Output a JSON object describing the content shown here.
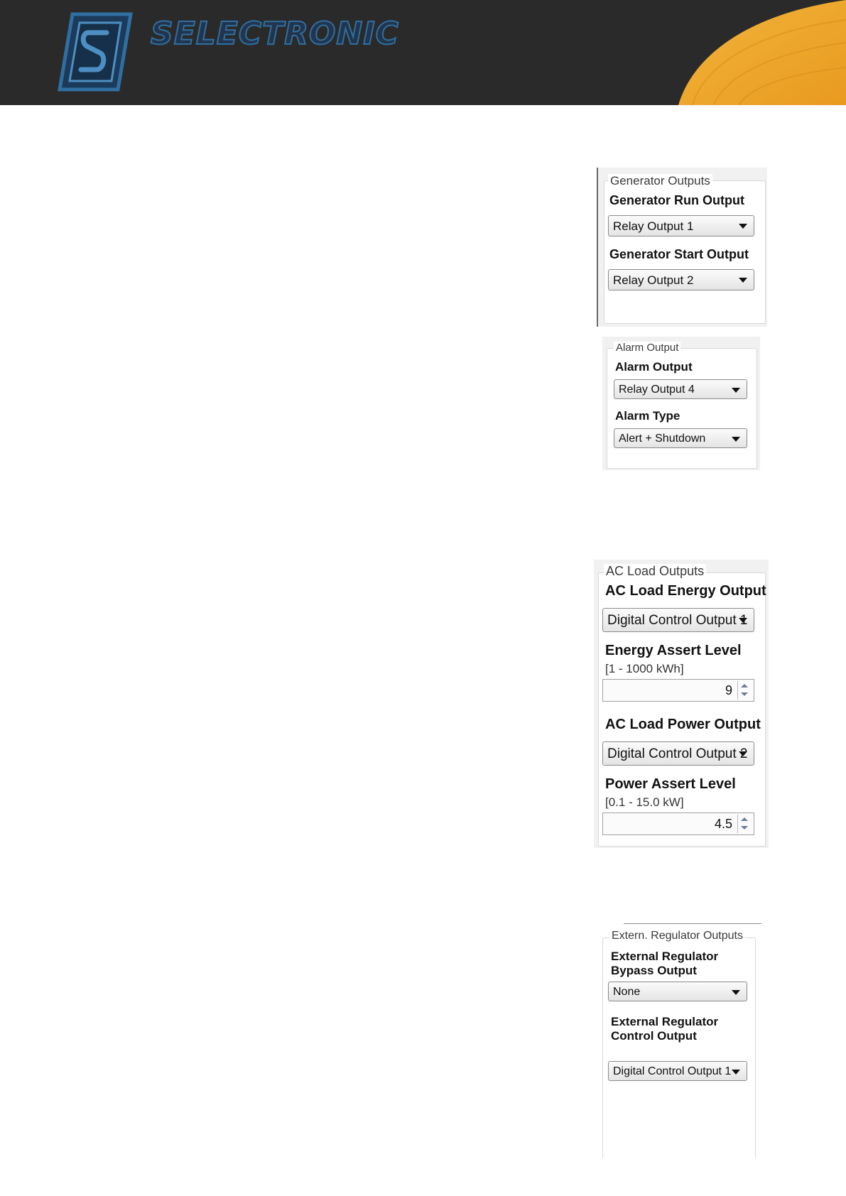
{
  "header": {
    "brand": "SELECTRONIC",
    "logo_icon": "selectronic-logo-icon"
  },
  "generator_outputs": {
    "legend": "Generator Outputs",
    "run_label": "Generator Run Output",
    "run_value": "Relay Output 1",
    "start_label": "Generator Start Output",
    "start_value": "Relay Output 2"
  },
  "alarm_output": {
    "legend": "Alarm Output",
    "output_label": "Alarm Output",
    "output_value": "Relay Output 4",
    "type_label": "Alarm Type",
    "type_value": "Alert + Shutdown"
  },
  "ac_load_outputs": {
    "legend": "AC Load Outputs",
    "energy_label": "AC Load Energy Output",
    "energy_value": "Digital Control Output 1",
    "energy_assert_label": "Energy Assert Level",
    "energy_assert_range": "[1 - 1000 kWh]",
    "energy_assert_value": "9",
    "power_label": "AC Load Power Output",
    "power_value": "Digital Control Output 2",
    "power_assert_label": "Power Assert Level",
    "power_assert_range": "[0.1 - 15.0 kW]",
    "power_assert_value": "4.5"
  },
  "extern_regulator_outputs": {
    "legend": "Extern. Regulator Outputs",
    "bypass_label_line1": "External Regulator",
    "bypass_label_line2": "Bypass Output",
    "bypass_value": "None",
    "control_label_line1": "External Regulator",
    "control_label_line2": "Control Output",
    "control_value": "Digital Control Output 1"
  }
}
